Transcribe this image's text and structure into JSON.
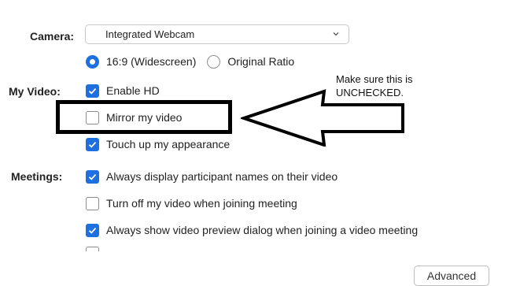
{
  "camera": {
    "label": "Camera:",
    "selected": "Integrated Webcam",
    "aspect_options": [
      {
        "label": "16:9 (Widescreen)",
        "selected": true
      },
      {
        "label": "Original Ratio",
        "selected": false
      }
    ]
  },
  "my_video": {
    "label": "My Video:",
    "options": [
      {
        "label": "Enable HD",
        "checked": true
      },
      {
        "label": "Mirror my video",
        "checked": false
      },
      {
        "label": "Touch up my appearance",
        "checked": true
      }
    ]
  },
  "meetings": {
    "label": "Meetings:",
    "options": [
      {
        "label": "Always display participant names on their video",
        "checked": true
      },
      {
        "label": "Turn off my video when joining meeting",
        "checked": false
      },
      {
        "label": "Always show video preview dialog when joining a video meeting",
        "checked": true
      }
    ]
  },
  "annotation": {
    "line1": "Make sure this is",
    "line2": "UNCHECKED."
  },
  "advanced_label": "Advanced",
  "colors": {
    "accent": "#1e6fe0",
    "annotation": "#000000"
  },
  "icons": {
    "dropdown": "chevron-down-icon",
    "check": "checkmark-icon",
    "arrow": "left-arrow-icon"
  }
}
